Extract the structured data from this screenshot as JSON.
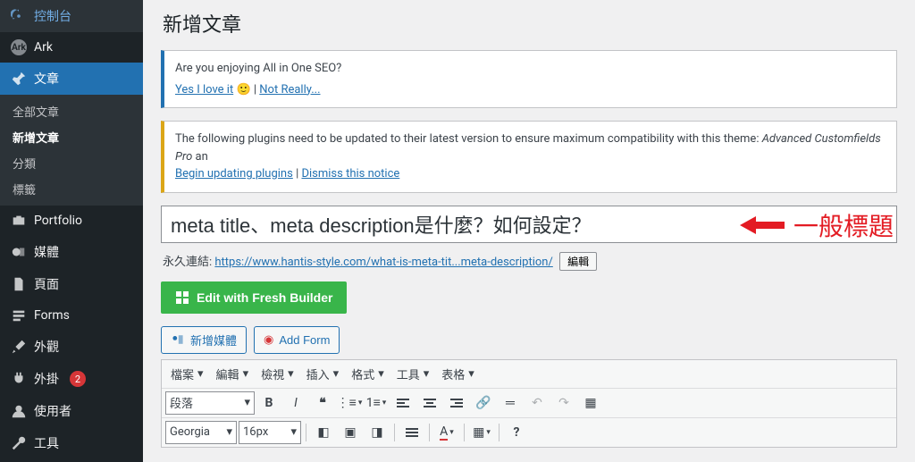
{
  "sidebar": {
    "items": [
      {
        "icon": "gauge",
        "label": "控制台"
      },
      {
        "icon": "ark",
        "label": "Ark"
      },
      {
        "icon": "pin",
        "label": "文章",
        "active": true
      },
      {
        "icon": "portfolio",
        "label": "Portfolio"
      },
      {
        "icon": "media",
        "label": "媒體"
      },
      {
        "icon": "page",
        "label": "頁面"
      },
      {
        "icon": "forms",
        "label": "Forms"
      },
      {
        "icon": "brush",
        "label": "外觀"
      },
      {
        "icon": "plug",
        "label": "外掛",
        "badge": 2
      },
      {
        "icon": "user",
        "label": "使用者"
      },
      {
        "icon": "wrench",
        "label": "工具"
      }
    ],
    "submenu": [
      {
        "label": "全部文章"
      },
      {
        "label": "新增文章",
        "active": true
      },
      {
        "label": "分類"
      },
      {
        "label": "標籤"
      }
    ]
  },
  "page": {
    "title": "新增文章",
    "seo_notice": {
      "q": "Are you enjoying All in One SEO?",
      "yes": "Yes I love it",
      "face": "🙂",
      "sep": " | ",
      "no": "Not Really..."
    },
    "plugin_notice": {
      "text_a": "The following plugins need to be updated to their latest version to ensure maximum compatibility with this theme: ",
      "em": "Advanced Customfields Pro",
      "text_b": " an",
      "link1": "Begin updating plugins",
      "sep": " | ",
      "link2": "Dismiss this notice"
    },
    "title_input": "meta title、meta description是什麼？如何設定？",
    "permalink": {
      "label": "永久連結: ",
      "url": "https://www.hantis-style.com/what-is-meta-tit...meta-description/",
      "edit": "編輯"
    },
    "fresh_btn": "Edit with Fresh Builder",
    "media_btn": "新增媒體",
    "form_btn": "Add Form",
    "editor": {
      "menus": [
        "檔案",
        "編輯",
        "檢視",
        "插入",
        "格式",
        "工具",
        "表格"
      ],
      "format_sel": "段落",
      "font_sel": "Georgia",
      "size_sel": "16px"
    },
    "annotation": "一般標題"
  }
}
